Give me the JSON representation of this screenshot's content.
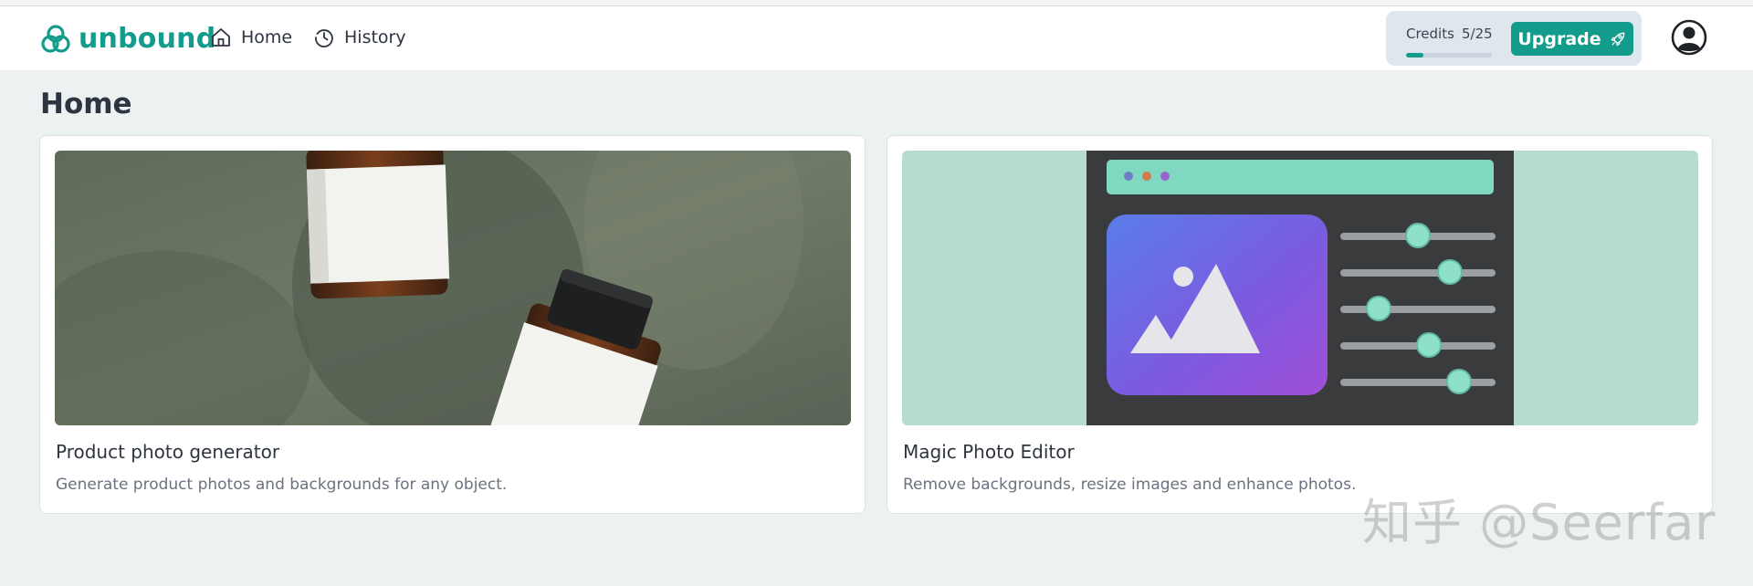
{
  "app": {
    "logo_text": "unbound"
  },
  "nav": [
    {
      "label": "Home",
      "icon": "home-icon"
    },
    {
      "label": "History",
      "icon": "history-icon"
    }
  ],
  "credits": {
    "label": "Credits",
    "value": "5/25",
    "used": 5,
    "total": 25
  },
  "upgrade": {
    "label": "Upgrade",
    "icon": "rocket-icon"
  },
  "page": {
    "title": "Home"
  },
  "cards": [
    {
      "title": "Product photo generator",
      "description": "Generate product photos and backgrounds for any object.",
      "image": "product-bottles-image"
    },
    {
      "title": "Magic Photo Editor",
      "description": "Remove backgrounds, resize images and enhance photos.",
      "image": "photo-editor-illustration"
    }
  ],
  "watermark": "知乎 @Seerfar",
  "colors": {
    "accent": "#139c8b",
    "background": "#ecf1f1",
    "text": "#2e3440"
  }
}
